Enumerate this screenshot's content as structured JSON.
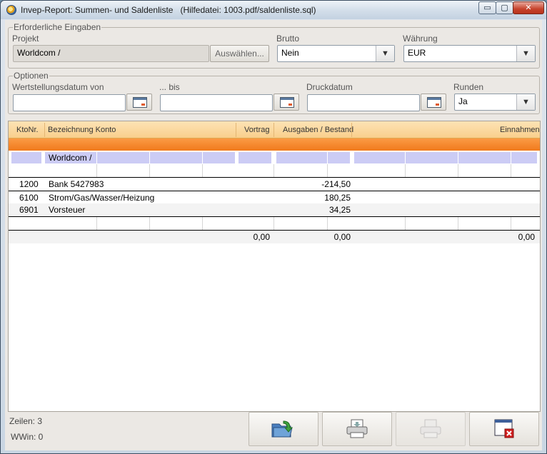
{
  "window": {
    "title": "Invep-Report: Summen- und Saldenliste   (Hilfedatei: 1003.pdf/saldenliste.sql)",
    "minimize_glyph": "▭",
    "maximize_glyph": "▢",
    "close_glyph": "✕"
  },
  "required": {
    "legend": "Erforderliche Eingaben",
    "projekt_label": "Projekt",
    "projekt_value": "Worldcom /",
    "select_button": "Auswählen...",
    "brutto_label": "Brutto",
    "brutto_value": "Nein",
    "waehrung_label": "Währung",
    "waehrung_value": "EUR"
  },
  "options": {
    "legend": "Optionen",
    "von_label": "Wertstellungsdatum von",
    "von_value": "",
    "bis_label": "... bis",
    "bis_value": "",
    "druck_label": "Druckdatum",
    "druck_value": "",
    "runden_label": "Runden",
    "runden_value": "Ja"
  },
  "table": {
    "columns": {
      "kto": "KtoNr.",
      "bez": "Bezeichnung Konto",
      "vortrag": "Vortrag",
      "ausgaben": "Ausgaben / Bestand",
      "einnahmen": "Einnahmen"
    },
    "group_label": "Worldcom /",
    "rows": [
      {
        "kto": "1200",
        "bez": "Bank 5427983",
        "ausgaben": "-214,50"
      },
      {
        "kto": "6100",
        "bez": "Strom/Gas/Wasser/Heizung",
        "ausgaben": "180,25"
      },
      {
        "kto": "6901",
        "bez": "Vorsteuer",
        "ausgaben": "34,25"
      }
    ],
    "totals": {
      "vortrag": "0,00",
      "ausgaben": "0,00",
      "einnahmen": "0,00"
    }
  },
  "status": {
    "zeilen": "Zeilen: 3",
    "wwin": "WWin: 0"
  },
  "toolbar": {
    "icons": [
      "export-folder-icon",
      "printer-icon",
      "print-preview-icon",
      "close-window-icon"
    ]
  },
  "colors": {
    "header_bg": "#f9cf8c",
    "orange_bar": "#f07a1c",
    "group_row": "#ccccf5"
  }
}
